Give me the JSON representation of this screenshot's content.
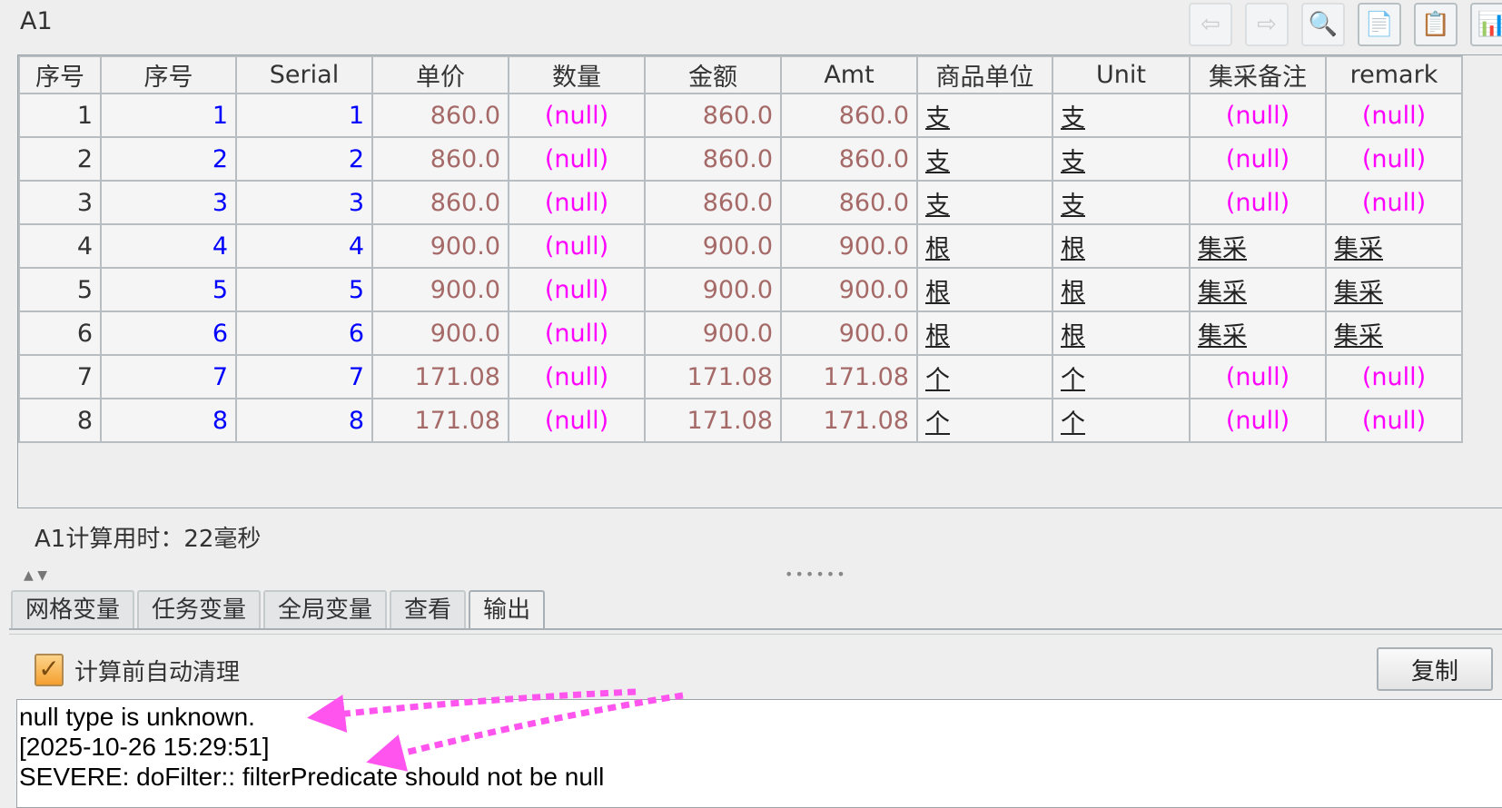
{
  "cell_name": "A1",
  "toolbar": [
    {
      "icon": "back-arrow-icon",
      "glyph": "⇦",
      "enabled": false
    },
    {
      "icon": "forward-arrow-icon",
      "glyph": "⇨",
      "enabled": false
    },
    {
      "icon": "preview-search-icon",
      "glyph": "🔍",
      "enabled": false
    },
    {
      "icon": "copy-documents-icon",
      "glyph": "📄",
      "enabled": true
    },
    {
      "icon": "list-icon",
      "glyph": "📋",
      "enabled": true
    },
    {
      "icon": "bar-chart-icon",
      "glyph": "📊",
      "enabled": true
    }
  ],
  "table": {
    "headers": [
      "序号",
      "序号",
      "Serial",
      "单价",
      "数量",
      "金额",
      "Amt",
      "商品单位",
      "Unit",
      "集采备注",
      "remark"
    ],
    "rows": [
      [
        "1",
        "1",
        "1",
        "860.0",
        "(null)",
        "860.0",
        "860.0",
        "支",
        "支",
        "(null)",
        "(null)"
      ],
      [
        "2",
        "2",
        "2",
        "860.0",
        "(null)",
        "860.0",
        "860.0",
        "支",
        "支",
        "(null)",
        "(null)"
      ],
      [
        "3",
        "3",
        "3",
        "860.0",
        "(null)",
        "860.0",
        "860.0",
        "支",
        "支",
        "(null)",
        "(null)"
      ],
      [
        "4",
        "4",
        "4",
        "900.0",
        "(null)",
        "900.0",
        "900.0",
        "根",
        "根",
        "集采",
        "集采"
      ],
      [
        "5",
        "5",
        "5",
        "900.0",
        "(null)",
        "900.0",
        "900.0",
        "根",
        "根",
        "集采",
        "集采"
      ],
      [
        "6",
        "6",
        "6",
        "900.0",
        "(null)",
        "900.0",
        "900.0",
        "根",
        "根",
        "集采",
        "集采"
      ],
      [
        "7",
        "7",
        "7",
        "171.08",
        "(null)",
        "171.08",
        "171.08",
        "个",
        "个",
        "(null)",
        "(null)"
      ],
      [
        "8",
        "8",
        "8",
        "171.08",
        "(null)",
        "171.08",
        "171.08",
        "个",
        "个",
        "(null)",
        "(null)"
      ]
    ]
  },
  "status": "A1计算用时：22毫秒",
  "tabs": [
    "网格变量",
    "任务变量",
    "全局变量",
    "查看",
    "输出"
  ],
  "active_tab": 4,
  "auto_clear_label": "计算前自动清理",
  "auto_clear_checked": true,
  "copy_label": "复制",
  "output_lines": [
    "null type is unknown.",
    "[2025-10-26 15:29:51]",
    "SEVERE: doFilter:: filterPredicate should not be null"
  ],
  "colors": {
    "serial": "#0000ff",
    "number": "#a56a68",
    "null": "#ff00ff",
    "annotation_arrow": "#ff55ee"
  }
}
